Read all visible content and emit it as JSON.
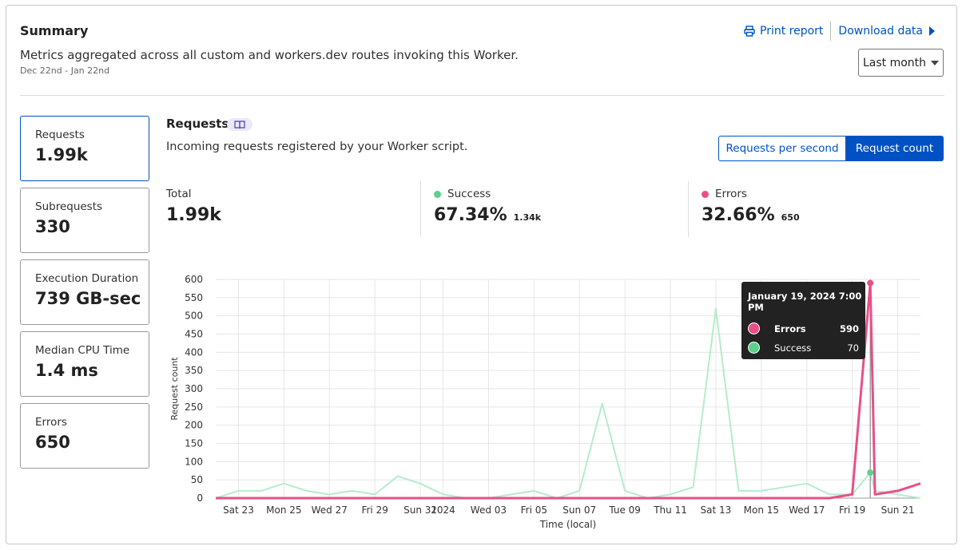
{
  "summary": {
    "title": "Summary",
    "description": "Metrics aggregated across all custom and workers.dev routes invoking this Worker.",
    "date_range": "Dec 22nd - Jan 22nd",
    "print_label": "Print report",
    "download_label": "Download data",
    "period": "Last month"
  },
  "tiles": [
    {
      "label": "Requests",
      "value": "1.99k"
    },
    {
      "label": "Subrequests",
      "value": "330"
    },
    {
      "label": "Execution Duration",
      "value": "739 GB-sec"
    },
    {
      "label": "Median CPU Time",
      "value": "1.4 ms"
    },
    {
      "label": "Errors",
      "value": "650"
    }
  ],
  "requests": {
    "title": "Requests",
    "description": "Incoming requests registered by your Worker script.",
    "toggle": {
      "per_second": "Requests per second",
      "count": "Request count"
    },
    "total": {
      "label": "Total",
      "value": "1.99k"
    },
    "success": {
      "label": "Success",
      "value": "67.34%",
      "count": "1.34k"
    },
    "errors": {
      "label": "Errors",
      "value": "32.66%",
      "count": "650"
    }
  },
  "colors": {
    "accent": "#0051c3",
    "success": "#5bd18b",
    "success_line": "#b5ecc9",
    "errors": "#e94f87"
  },
  "tooltip": {
    "title": "January 19, 2024 7:00 PM",
    "rows": [
      {
        "name": "Errors",
        "value": "590"
      },
      {
        "name": "Success",
        "value": "70"
      }
    ]
  },
  "chart_data": {
    "type": "line",
    "xlabel": "Time (local)",
    "ylabel": "Request count",
    "ylim": [
      0,
      600
    ],
    "yticks": [
      0,
      50,
      100,
      150,
      200,
      250,
      300,
      350,
      400,
      450,
      500,
      550,
      600
    ],
    "x_start": "2023-12-22",
    "x_end": "2024-01-22",
    "xticks": [
      {
        "label": "Sat 23",
        "date": "2023-12-23"
      },
      {
        "label": "Mon 25",
        "date": "2023-12-25"
      },
      {
        "label": "Wed 27",
        "date": "2023-12-27"
      },
      {
        "label": "Fri 29",
        "date": "2023-12-29"
      },
      {
        "label": "Sun 31",
        "date": "2023-12-31"
      },
      {
        "label": "2024",
        "date": "2024-01-01"
      },
      {
        "label": "Wed 03",
        "date": "2024-01-03"
      },
      {
        "label": "Fri 05",
        "date": "2024-01-05"
      },
      {
        "label": "Sun 07",
        "date": "2024-01-07"
      },
      {
        "label": "Tue 09",
        "date": "2024-01-09"
      },
      {
        "label": "Thu 11",
        "date": "2024-01-11"
      },
      {
        "label": "Sat 13",
        "date": "2024-01-13"
      },
      {
        "label": "Mon 15",
        "date": "2024-01-15"
      },
      {
        "label": "Wed 17",
        "date": "2024-01-17"
      },
      {
        "label": "Fri 19",
        "date": "2024-01-19"
      },
      {
        "label": "Sun 21",
        "date": "2024-01-21"
      }
    ],
    "series": [
      {
        "name": "Success",
        "points": [
          [
            "2023-12-22",
            0
          ],
          [
            "2023-12-23",
            20
          ],
          [
            "2023-12-24",
            20
          ],
          [
            "2023-12-25",
            40
          ],
          [
            "2023-12-26",
            20
          ],
          [
            "2023-12-27",
            10
          ],
          [
            "2023-12-28",
            20
          ],
          [
            "2023-12-29",
            10
          ],
          [
            "2023-12-30",
            60
          ],
          [
            "2023-12-31",
            40
          ],
          [
            "2024-01-01",
            10
          ],
          [
            "2024-01-02",
            0
          ],
          [
            "2024-01-03",
            0
          ],
          [
            "2024-01-04",
            10
          ],
          [
            "2024-01-05",
            20
          ],
          [
            "2024-01-06",
            0
          ],
          [
            "2024-01-07",
            20
          ],
          [
            "2024-01-08",
            260
          ],
          [
            "2024-01-09",
            20
          ],
          [
            "2024-01-10",
            0
          ],
          [
            "2024-01-11",
            10
          ],
          [
            "2024-01-12",
            30
          ],
          [
            "2024-01-13",
            520
          ],
          [
            "2024-01-14",
            20
          ],
          [
            "2024-01-15",
            20
          ],
          [
            "2024-01-16",
            30
          ],
          [
            "2024-01-17",
            40
          ],
          [
            "2024-01-18",
            10
          ],
          [
            "2024-01-19",
            10
          ],
          [
            "2024-01-19T19:00",
            70
          ],
          [
            "2024-01-20",
            20
          ],
          [
            "2024-01-21",
            10
          ],
          [
            "2024-01-22",
            0
          ]
        ]
      },
      {
        "name": "Errors",
        "points": [
          [
            "2023-12-22",
            0
          ],
          [
            "2024-01-18",
            0
          ],
          [
            "2024-01-19",
            10
          ],
          [
            "2024-01-19T19:00",
            590
          ],
          [
            "2024-01-20",
            10
          ],
          [
            "2024-01-21",
            20
          ],
          [
            "2024-01-22",
            40
          ]
        ]
      }
    ],
    "hover": {
      "date": "2024-01-19T19:00"
    },
    "grid": true,
    "legend": "none"
  }
}
